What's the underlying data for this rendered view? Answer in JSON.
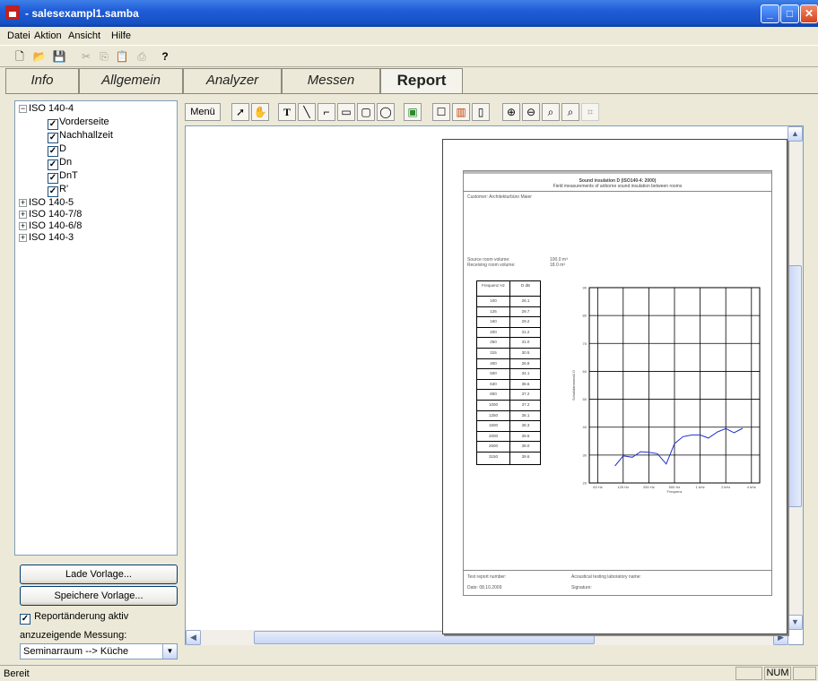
{
  "window": {
    "title": "- salesexampl1.samba"
  },
  "menu": [
    "Datei",
    "Aktion",
    "Ansicht",
    "Hilfe"
  ],
  "toolbar": {
    "icons": [
      "new-icon",
      "open-icon",
      "save-icon",
      "cut-icon",
      "copy-icon",
      "paste-icon",
      "print-icon",
      "help-icon"
    ]
  },
  "tabs": [
    "Info",
    "Allgemein",
    "Analyzer",
    "Messen",
    "Report"
  ],
  "active_tab": "Report",
  "tree": {
    "root": "ISO 140-4",
    "children": [
      "Vorderseite",
      "Nachhallzeit",
      "D",
      "Dn",
      "DnT",
      "R'"
    ],
    "others": [
      "ISO 140-5",
      "ISO 140-7/8",
      "ISO 140-6/8",
      "ISO 140-3"
    ]
  },
  "buttons": {
    "load": "Lade Vorlage...",
    "save": "Speichere Vorlage..."
  },
  "checkbox_label": "Reportänderung aktiv",
  "measure_label": "anzuzeigende Messung:",
  "measure_value": "Seminarraum --> Küche",
  "report_toolbar": {
    "menu_label": "Menü"
  },
  "report": {
    "title": "Sound insulation D (ISO140-4: 2000)",
    "subtitle": "Field measurements of airborne sound insulation between rooms",
    "customer": "Customer: Architekturbüro Maier",
    "source_vol_label": "Source room volume:",
    "source_vol": "100.0 m³",
    "recv_vol_label": "Receiving room volume:",
    "recv_vol": "18.0 m³",
    "table_head": [
      "Frequenz Hz",
      "D dB"
    ],
    "rows": [
      [
        "100",
        "26.1"
      ],
      [
        "125",
        "29.7"
      ],
      [
        "160",
        "29.2"
      ],
      [
        "200",
        "31.2"
      ],
      [
        "250",
        "31.0"
      ],
      [
        "315",
        "30.5"
      ],
      [
        "400",
        "26.8"
      ],
      [
        "500",
        "34.1"
      ],
      [
        "630",
        "36.6"
      ],
      [
        "800",
        "37.2"
      ],
      [
        "1000",
        "37.2"
      ],
      [
        "1250",
        "36.1"
      ],
      [
        "1600",
        "38.3"
      ],
      [
        "2000",
        "39.5"
      ],
      [
        "2500",
        "38.0"
      ],
      [
        "3150",
        "39.6"
      ]
    ],
    "footer_left1": "Test report number:",
    "footer_right1": "Acoustical testing laboratory name:",
    "footer_left2": "Date: 08.10.2009",
    "footer_right2": "Signature:"
  },
  "chart_data": {
    "type": "line",
    "ylabel": "Schalldämmmaß D",
    "xlabel": "Frequenz",
    "yticks": [
      "20",
      "30",
      "40",
      "50",
      "60",
      "70",
      "80",
      "90"
    ],
    "xticks": [
      "63 Hz",
      "125 Hz",
      "250 Hz",
      "500 Hz",
      "1 kHz",
      "2 kHz",
      "4 kHz"
    ],
    "ylim": [
      20,
      90
    ],
    "x": [
      100,
      125,
      160,
      200,
      250,
      315,
      400,
      500,
      630,
      800,
      1000,
      1250,
      1600,
      2000,
      2500,
      3150
    ],
    "series": [
      {
        "values": [
          26.1,
          29.7,
          29.2,
          31.2,
          31.0,
          30.5,
          26.8,
          34.1,
          36.6,
          37.2,
          37.2,
          36.1,
          38.3,
          39.5,
          38.0,
          39.6
        ],
        "color": "#2030d0"
      }
    ]
  },
  "status": {
    "text": "Bereit",
    "num": "NUM"
  }
}
